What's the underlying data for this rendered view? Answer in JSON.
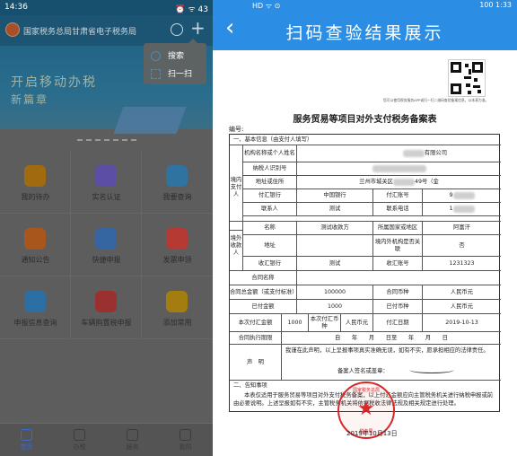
{
  "left": {
    "status": {
      "time": "14:36",
      "right": "⏰ ᯤ 43"
    },
    "header": {
      "title": "国家税务总局甘肃省电子税务局",
      "plus": "+"
    },
    "banner": {
      "line1": "开启移动办税",
      "line2": "新篇章"
    },
    "popup": {
      "search": "搜索",
      "scan": "扫一扫"
    },
    "grid": [
      {
        "label": "我的待办",
        "color": "#a16a0f"
      },
      {
        "label": "实名认证",
        "color": "#5c4da5"
      },
      {
        "label": "我要查询",
        "color": "#2f73a1"
      },
      {
        "label": "通知公告",
        "color": "#a8561b"
      },
      {
        "label": "快捷申报",
        "color": "#3666a2"
      },
      {
        "label": "发票申领",
        "color": "#b43a33"
      },
      {
        "label": "申报信息查询",
        "color": "#2e6fa3"
      },
      {
        "label": "车辆购置税申报",
        "color": "#9a3030"
      },
      {
        "label": "添加常用",
        "color": "#a37d10"
      }
    ],
    "nav": [
      {
        "label": "首页",
        "active": true
      },
      {
        "label": "办税",
        "active": false
      },
      {
        "label": "服务",
        "active": false
      },
      {
        "label": "我的",
        "active": false
      }
    ]
  },
  "right": {
    "status": {
      "left": "HD ᯤ ⊙",
      "right": "100 1:33"
    },
    "title": "扫码查验结果展示",
    "qr_note": "您可以使用税务服务APP或扫一扫二维码查验备案信息，以本表为准。",
    "doc_title": "服务贸易等项目对外支付税务备案表",
    "doc_no": "编号:",
    "section1": "一、基本信息（由支付人填写）",
    "payer_group": "境内支付人",
    "payee_group": "境外收款人",
    "rows": {
      "org_name_label": "机构名称或个人姓名",
      "org_name_value": "有限公司",
      "tax_id_label": "纳税人识别号",
      "address_label": "地址或住所",
      "address_value": "兰州市城关区",
      "address_value2": "49号（金",
      "bank_label": "付汇银行",
      "bank_value": "中国银行",
      "account_label": "付汇账号",
      "account_value": "9",
      "contact_label": "联系人",
      "contact_value": "测试",
      "phone_label": "联系电话",
      "phone_value": "1",
      "name_label": "名称",
      "name_value": "测试收款方",
      "country_label": "所属国家或地区",
      "country_value": "阿富汗",
      "addr2_label": "地址",
      "overseas_label": "境内外机构是否关联",
      "overseas_value": "否",
      "recv_bank_label": "收汇银行",
      "recv_bank_value": "测试",
      "recv_account_label": "收汇账号",
      "recv_account_value": "1231323",
      "contract_name_label": "合同名称",
      "total_label": "合同总金额（或支付标准）",
      "total_value": "100000",
      "currency_label": "合同币种",
      "currency_value": "人民币元",
      "paid_label": "已付金额",
      "paid_value": "1000",
      "paid_currency_label": "已付币种",
      "paid_currency_value": "人民币元",
      "this_amount_label": "本次付汇金额",
      "this_amount_value": "1000",
      "this_currency_label": "本次付汇币种",
      "this_currency_value": "人民币元",
      "pay_date_label": "付汇日期",
      "pay_date_value": "2019-10-13",
      "contract_period_label": "合同执行期限",
      "period_text": "自　　年　　月　　日至　　年　　月　　日",
      "declare_label": "声　明",
      "declare_text": "我谨在此声明，以上呈报事项真实准确无误，如有不实，愿承担相应的法律责任。",
      "sign_text": "备案人签名或盖章："
    },
    "section2": "二、告知事项",
    "notice": "本表仅适用于服务贸易等项目对外支付税务备案，以上付汇金额应向主管税务机关进行纳税申报或前由必要说明。上述呈报如有不实，主管税务机关将依据税收法律法规及相关规定进行处理。",
    "stamp_top": "国家税务总局",
    "stamp_bottom": "税务局",
    "date_text": "2019年10月13日"
  }
}
